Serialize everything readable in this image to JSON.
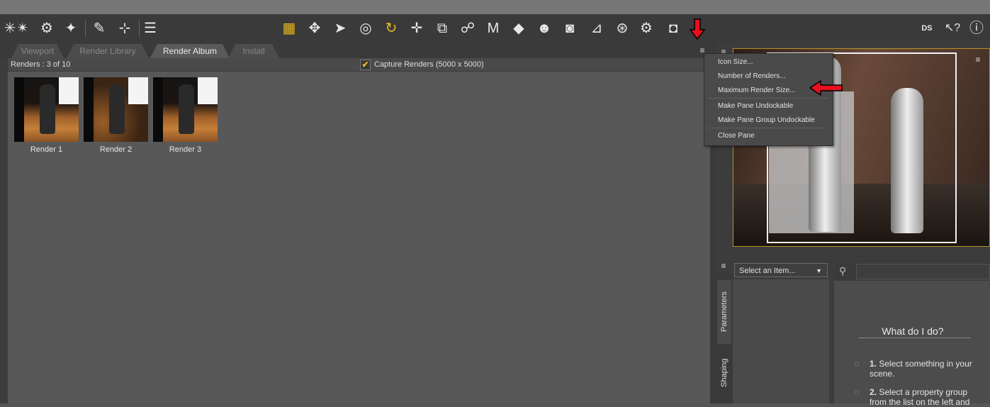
{
  "toolbar": {
    "icons": [
      "new-icon",
      "open-icon",
      "save-icon",
      "figure-icon",
      "geometry-icon",
      "align-icon",
      "render-settings-icon",
      "move-icon",
      "select-icon",
      "node-icon",
      "rotate-icon",
      "translate-icon",
      "scale-icon",
      "joint-icon",
      "morph-icon",
      "paint-icon",
      "surface-icon",
      "camera-icon",
      "region-icon",
      "spot-render-icon",
      "render-icon",
      "screenshot-icon",
      "home-icon",
      "help-icon",
      "question-icon"
    ],
    "home_label": "DS"
  },
  "tabs": [
    {
      "label": "Viewport",
      "active": false
    },
    {
      "label": "Render Library",
      "active": false
    },
    {
      "label": "Render Album",
      "active": true
    },
    {
      "label": "Install",
      "active": false
    }
  ],
  "album": {
    "count_label": "Renders : 3 of 10",
    "capture_label": "Capture Renders (5000 x 5000)",
    "capture_checked": true,
    "renders": [
      {
        "label": "Render 1"
      },
      {
        "label": "Render 2"
      },
      {
        "label": "Render 3"
      }
    ]
  },
  "context_menu": {
    "items": [
      {
        "label": "Icon Size..."
      },
      {
        "label": "Number of Renders..."
      },
      {
        "label": "Maximum Render Size..."
      },
      {
        "label": "Make Pane Undockable"
      },
      {
        "label": "Make Pane Group Undockable"
      },
      {
        "label": "Close Pane"
      }
    ],
    "highlighted_index": 2
  },
  "parameters": {
    "tabs": [
      {
        "label": "Parameters",
        "active": true
      },
      {
        "label": "Shaping",
        "active": false
      }
    ],
    "select_label": "Select an Item...",
    "help": {
      "title": "What do I do?",
      "steps": [
        {
          "num": "1.",
          "text": "Select something in your scene."
        },
        {
          "num": "2.",
          "text": "Select a property group from the list on the left and"
        }
      ]
    }
  },
  "colors": {
    "accent": "#e6b820",
    "annotation_arrow": "#e8101e"
  }
}
